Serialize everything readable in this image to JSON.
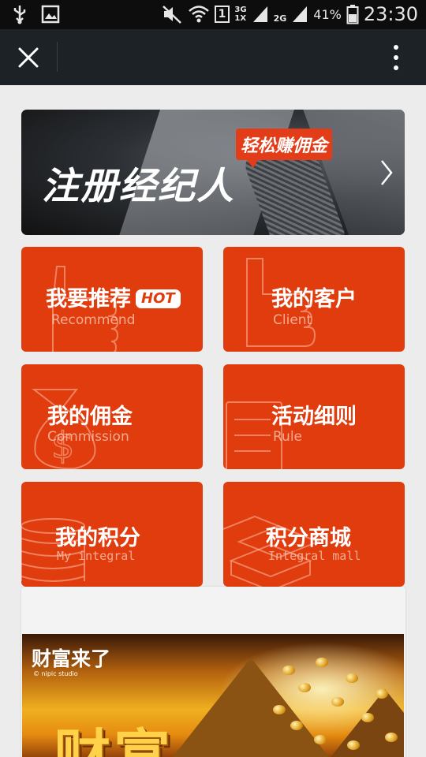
{
  "status_bar": {
    "battery_percent": "41%",
    "time": "23:30",
    "network_3g": "3G",
    "network_1x": "1X",
    "network_2g": "2G",
    "sim_slot": "1"
  },
  "title_bar": {
    "title": ""
  },
  "banner": {
    "title": "注册经纪人",
    "tag": "轻松赚佣金"
  },
  "tiles": [
    {
      "title": "我要推荐",
      "badge": "HOT",
      "subtitle": "Recommend"
    },
    {
      "title": "我的客户",
      "subtitle": "Client"
    },
    {
      "title": "我的佣金",
      "subtitle": "Commission"
    },
    {
      "title": "活动细则",
      "subtitle": "Rule"
    },
    {
      "title": "我的积分",
      "subtitle": "My integral"
    },
    {
      "title": "积分商城",
      "subtitle": "Integral mall"
    }
  ],
  "promo": {
    "title": "财富来了",
    "watermark": "© nipic studio",
    "big_text": "财富"
  },
  "colors": {
    "tile_red": "#e03c0d",
    "title_bar": "#1d2227",
    "status_bar": "#0d0d0d",
    "background": "#ececec"
  }
}
